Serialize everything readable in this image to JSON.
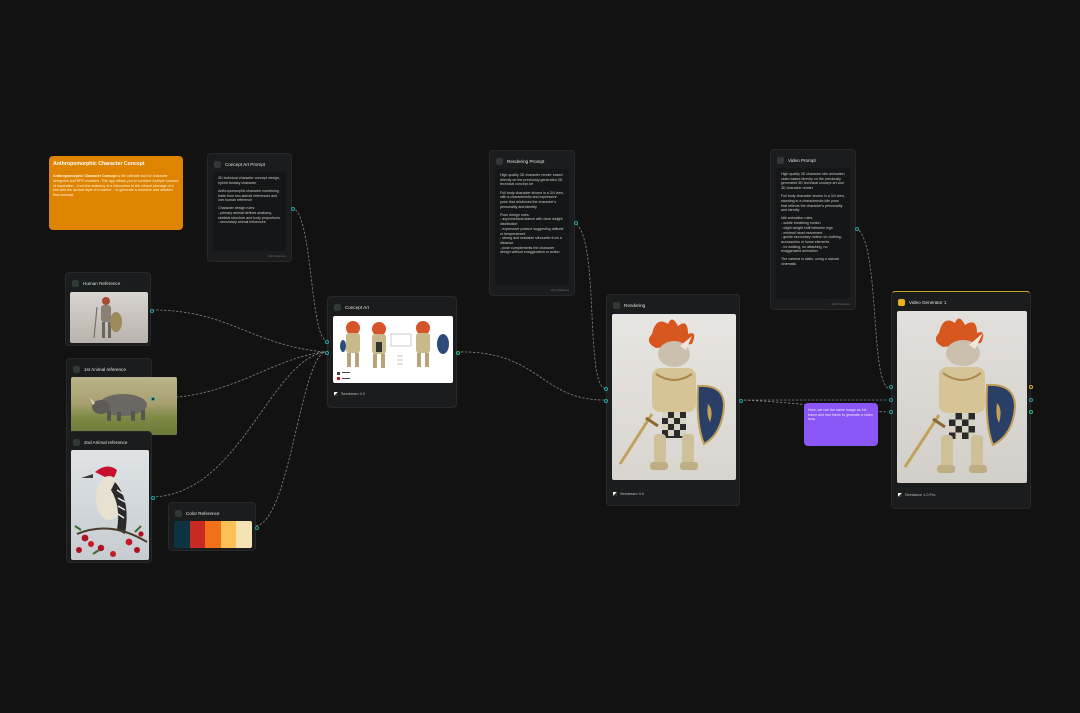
{
  "notes": {
    "concept": {
      "title": "Anthropomorphic Character Concept",
      "lead": "Anthropomorphic Character Concept",
      "body": " is the ultimate tool for character designers and RPG modders. This app allows you to combine multiple sources of inspiration – from the anatomy of a rhinoceros to the vibrant plumage of a bird and the tactical style of a warrior – to generate a cohesive and detailed final concept."
    },
    "video_hint": "Here, we use the same image as 1st frame and last frame to generate a video loop."
  },
  "nodes": {
    "concept_prompt": {
      "title": "Concept Art Prompt",
      "paragraphs": [
        "3D technical character concept design, hybrid fantasy character",
        "Anthropomorphic character combining traits from two animal references and one human reference",
        "Character design rules:\n- primary animal defines anatomy, skeletal structure and body proportions\n- secondary animal influences"
      ],
      "footer": "1234 characters"
    },
    "rendering_prompt": {
      "title": "Rendering Prompt",
      "paragraphs": [
        "High quality 3D character render based directly on the previously generated 3D technical concept art",
        "Full body character shown in a 3/4 view, with a characteristic and expressive pose that reinforces the character's personality and identity",
        "Pose design rules:\n- asymmetrical stance with clear weight distribution\n- expressive posture suggesting attitude or temperament\n- strong and readable silhouette from a distance\n- pose complements the character design without exaggeration or action"
      ],
      "footer": "1371 characters"
    },
    "video_prompt": {
      "title": "Video Prompt",
      "paragraphs": [
        "High quality 3D character idle animation video based directly on the previously generated 3D technical concept art and 3D character render",
        "Full body character shown in a 3/4 view, standing in a characteristic idle pose that reflects the character's personality and identity",
        "Idle animation rules:\n- subtle breathing motion\n- slight weight shift between legs\n- minimal head movement\n- gentle secondary motion on clothing, accessories or loose elements\n- no walking, no attacking, no exaggerated animation",
        "The camera is static, using a natural cinematic"
      ],
      "footer": "1468 characters"
    },
    "human_ref": {
      "title": "Human Reference"
    },
    "animal1": {
      "title": "1st Animal reference"
    },
    "animal2": {
      "title": "2nd Animal reference"
    },
    "color_ref": {
      "title": "Color Reference",
      "colors": [
        "#0e3340",
        "#c62a22",
        "#f0711a",
        "#fdc056",
        "#f6e3b3"
      ]
    },
    "concept_art": {
      "title": "Concept Art",
      "model": "Seedream 4.0"
    },
    "rendering": {
      "title": "Rendering",
      "model": "Seedream 4.0"
    },
    "video_gen": {
      "title": "Video Generator 1",
      "model": "Seedance 1.0 Pro"
    }
  },
  "colors": {
    "background": "#121212",
    "wire": "#9a9a9a",
    "port": "#27a3a3",
    "note_orange": "#de8400",
    "note_purple": "#8a56f5"
  }
}
